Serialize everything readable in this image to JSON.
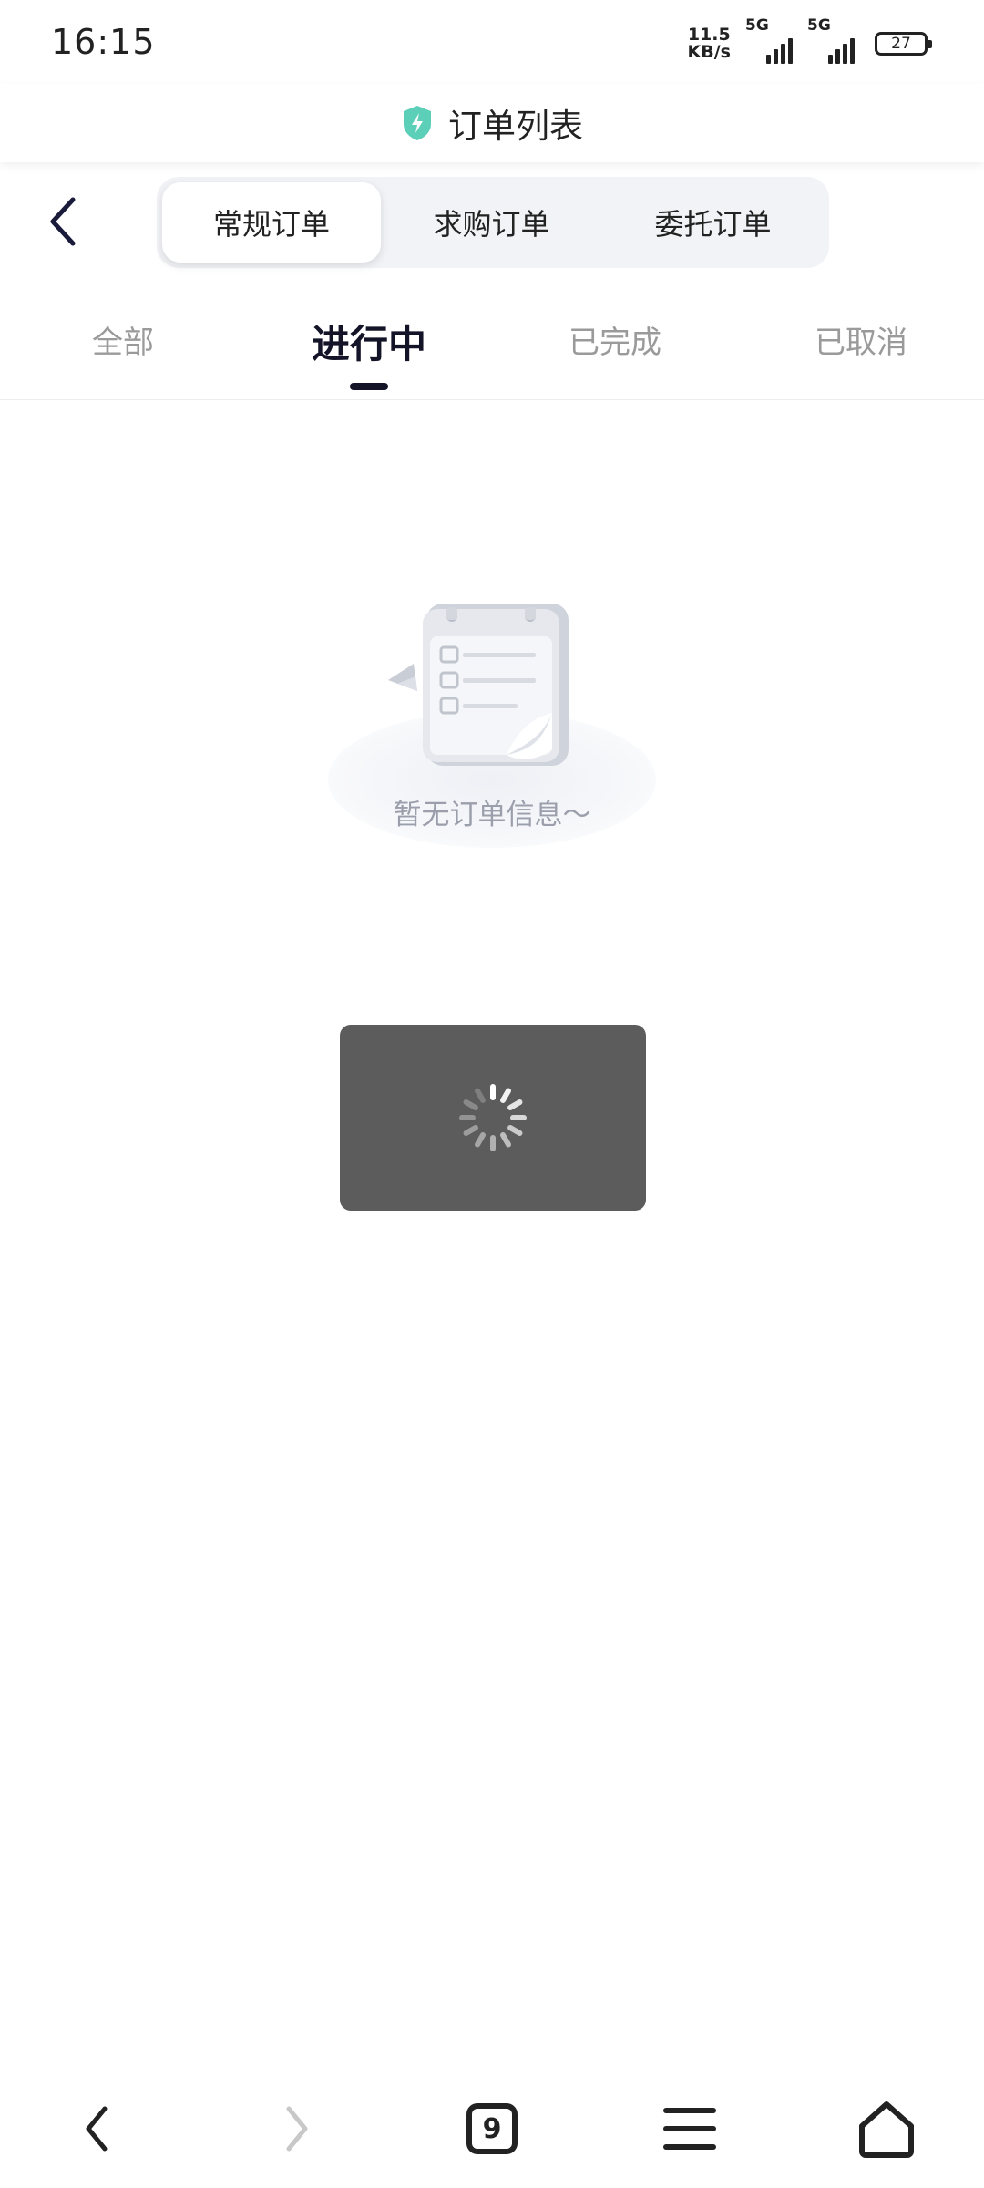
{
  "status_bar": {
    "time": "16:15",
    "net_speed_value": "11.5",
    "net_speed_unit": "KB/s",
    "sim1_label": "5G",
    "sim2_label": "5G",
    "battery": "27"
  },
  "title_bar": {
    "title": "订单列表",
    "shield_color": "#5ccfb9"
  },
  "segment": {
    "items": [
      "常规订单",
      "求购订单",
      "委托订单"
    ],
    "selected": "常规订单"
  },
  "tabs": {
    "items": [
      "全部",
      "进行中",
      "已完成",
      "已取消"
    ],
    "selected": "进行中"
  },
  "empty_state": {
    "message": "暂无订单信息～"
  },
  "bottom_nav": {
    "tab_count": "9"
  },
  "colors": {
    "accent": "#141428",
    "muted_text": "#9a9a9a",
    "toast_bg": "#5c5c5c"
  }
}
